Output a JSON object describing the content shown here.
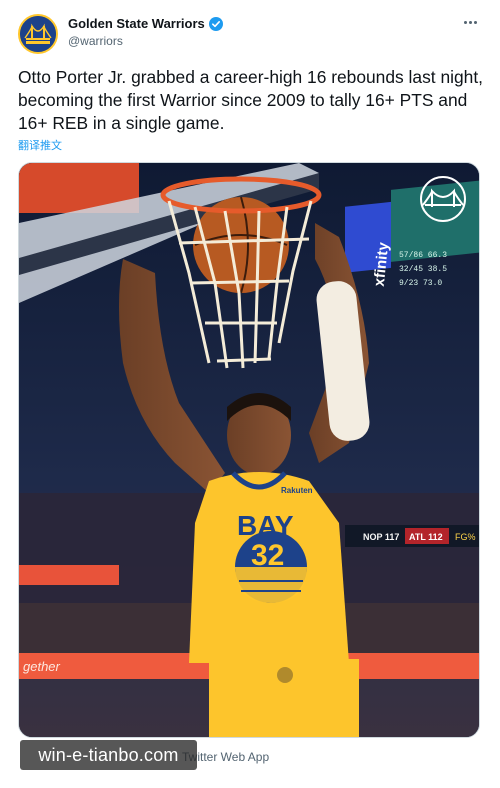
{
  "account": {
    "display_name": "Golden State Warriors",
    "handle": "@warriors",
    "verified": true,
    "avatar_icon": "bay-bridge-logo-icon"
  },
  "tweet": {
    "text": "Otto Porter Jr. grabbed a career-high 16 rebounds last night, becoming the first Warrior since 2009 to tally 16+ PTS and 16+ REB in a single game.",
    "translate_label": "翻译推文"
  },
  "media": {
    "jersey_text": "BAY",
    "jersey_number": "32",
    "jersey_sponsor": "Rakuten",
    "arena_sign": "xfinity",
    "scoreboard": {
      "rows": [
        "NOP 117",
        "ATL 112",
        "FG%"
      ],
      "side_rows": [
        "57/86 66.3",
        "32/45 38.5",
        "9/23 73.0"
      ]
    },
    "baseline_text": "gether",
    "team_logo_icon": "warriors-bridge-logo-icon"
  },
  "footer": {
    "date_time": "",
    "source": "Twitter Web App"
  },
  "watermark": {
    "text": "win-e-tianbo.com"
  },
  "colors": {
    "warriors_blue": "#1d428a",
    "warriors_gold": "#ffc72c",
    "link_blue": "#1d9bf0",
    "secondary_text": "#536471"
  }
}
